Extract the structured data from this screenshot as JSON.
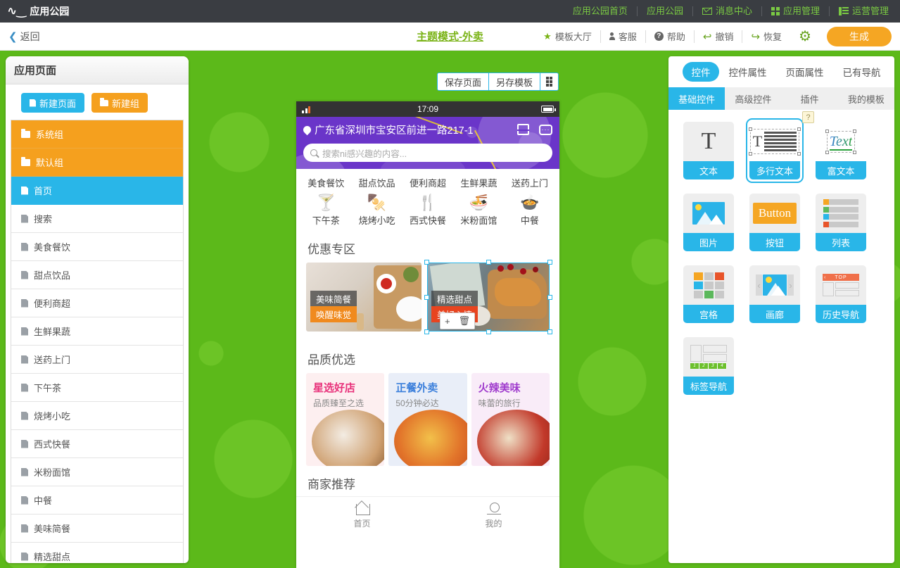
{
  "topbar": {
    "logo_text": "应用公园",
    "nav": [
      {
        "label": "应用公园首页",
        "icon": ""
      },
      {
        "label": "应用公园",
        "icon": ""
      },
      {
        "label": "消息中心",
        "icon": "mail-icon"
      },
      {
        "label": "应用管理",
        "icon": "grid-icon"
      },
      {
        "label": "运营管理",
        "icon": "list-icon"
      }
    ]
  },
  "toolbar": {
    "back_label": "返回",
    "title": "主题模式-外卖",
    "tools": [
      {
        "label": "模板大厅",
        "icon": "star-icon"
      },
      {
        "label": "客服",
        "icon": "person-icon"
      },
      {
        "label": "帮助",
        "icon": "question-icon"
      },
      {
        "label": "撤销",
        "icon": "undo-icon"
      },
      {
        "label": "恢复",
        "icon": "redo-icon"
      }
    ],
    "settings_icon": "gear-icon",
    "generate_label": "生成"
  },
  "left_panel": {
    "header": "应用页面",
    "new_page_label": "新建页面",
    "new_group_label": "新建组",
    "items": [
      {
        "label": "系统组",
        "type": "group",
        "icon": "folder-icon"
      },
      {
        "label": "默认组",
        "type": "group",
        "icon": "folder-open-icon"
      },
      {
        "label": "首页",
        "type": "page",
        "active": true,
        "icon": "doc-icon"
      },
      {
        "label": "搜索",
        "type": "page",
        "icon": "doc-icon"
      },
      {
        "label": "美食餐饮",
        "type": "page",
        "icon": "doc-icon"
      },
      {
        "label": "甜点饮品",
        "type": "page",
        "icon": "doc-icon"
      },
      {
        "label": "便利商超",
        "type": "page",
        "icon": "doc-icon"
      },
      {
        "label": "生鲜果蔬",
        "type": "page",
        "icon": "doc-icon"
      },
      {
        "label": "送药上门",
        "type": "page",
        "icon": "doc-icon"
      },
      {
        "label": "下午茶",
        "type": "page",
        "icon": "doc-icon"
      },
      {
        "label": "烧烤小吃",
        "type": "page",
        "icon": "doc-icon"
      },
      {
        "label": "西式快餐",
        "type": "page",
        "icon": "doc-icon"
      },
      {
        "label": "米粉面馆",
        "type": "page",
        "icon": "doc-icon"
      },
      {
        "label": "中餐",
        "type": "page",
        "icon": "doc-icon"
      },
      {
        "label": "美味简餐",
        "type": "page",
        "icon": "doc-icon"
      },
      {
        "label": "精选甜点",
        "type": "page",
        "icon": "doc-icon"
      }
    ]
  },
  "canvas": {
    "save_page_label": "保存页面",
    "save_template_label": "另存模板",
    "layout_icon": "double-column-icon",
    "phone": {
      "status_time": "17:09",
      "address": "广东省深圳市宝安区前进一路217-1",
      "search_placeholder": "搜索ni感兴趣的内容...",
      "categories_row1": [
        "美食餐饮",
        "甜点饮品",
        "便利商超",
        "生鲜果蔬",
        "送药上门"
      ],
      "categories_row2": [
        {
          "label": "下午茶",
          "glyph": "🍸"
        },
        {
          "label": "烧烤小吃",
          "glyph": "🍢"
        },
        {
          "label": "西式快餐",
          "glyph": "🍴"
        },
        {
          "label": "米粉面馆",
          "glyph": "🍜"
        },
        {
          "label": "中餐",
          "glyph": "🍲"
        }
      ],
      "promo_title": "优惠专区",
      "promo_cards": [
        {
          "title": "美味简餐",
          "sub": "唤醒味觉",
          "selected": false
        },
        {
          "title": "精选甜点",
          "sub": "美好心情",
          "selected": true
        }
      ],
      "selection_tools": {
        "add": "+",
        "delete": "🗑"
      },
      "quality_title": "品质优选",
      "quality_cards": [
        {
          "title": "星选好店",
          "sub": "品质臻至之选"
        },
        {
          "title": "正餐外卖",
          "sub": "50分钟必达"
        },
        {
          "title": "火辣美味",
          "sub": "味蕾的旅行"
        }
      ],
      "business_title": "商家推荐",
      "tabbar": [
        {
          "label": "首页",
          "icon": "home-icon"
        },
        {
          "label": "我的",
          "icon": "user-icon"
        }
      ]
    }
  },
  "right_panel": {
    "tabs": [
      {
        "label": "控件",
        "active": true
      },
      {
        "label": "控件属性",
        "active": false
      },
      {
        "label": "页面属性",
        "active": false
      },
      {
        "label": "已有导航",
        "active": false
      }
    ],
    "subtabs": [
      {
        "label": "基础控件",
        "active": true
      },
      {
        "label": "高级控件",
        "active": false
      },
      {
        "label": "插件",
        "active": false
      },
      {
        "label": "我的模板",
        "active": false
      }
    ],
    "help_badge": "?",
    "widgets": [
      {
        "label": "文本",
        "glyph": "T",
        "selected": false
      },
      {
        "label": "多行文本",
        "glyph": "multiline",
        "selected": true
      },
      {
        "label": "富文本",
        "glyph": "Text",
        "selected": false
      },
      {
        "label": "图片",
        "glyph": "image",
        "selected": false
      },
      {
        "label": "按钮",
        "glyph": "Button",
        "selected": false
      },
      {
        "label": "列表",
        "glyph": "list",
        "selected": false
      },
      {
        "label": "宫格",
        "glyph": "grid",
        "selected": false
      },
      {
        "label": "画廊",
        "glyph": "gallery",
        "selected": false
      },
      {
        "label": "历史导航",
        "glyph": "history",
        "selected": false
      },
      {
        "label": "标签导航",
        "glyph": "tabs",
        "selected": false
      }
    ],
    "history_top_label": "TOP",
    "tag_numbers": [
      "1",
      "2",
      "3",
      "4"
    ]
  },
  "colors": {
    "background_green": "#5cb91a",
    "accent_blue": "#29b6e8",
    "accent_orange": "#f5a01e",
    "title_green": "#7ab317",
    "phone_purple": "#6a35c9"
  }
}
